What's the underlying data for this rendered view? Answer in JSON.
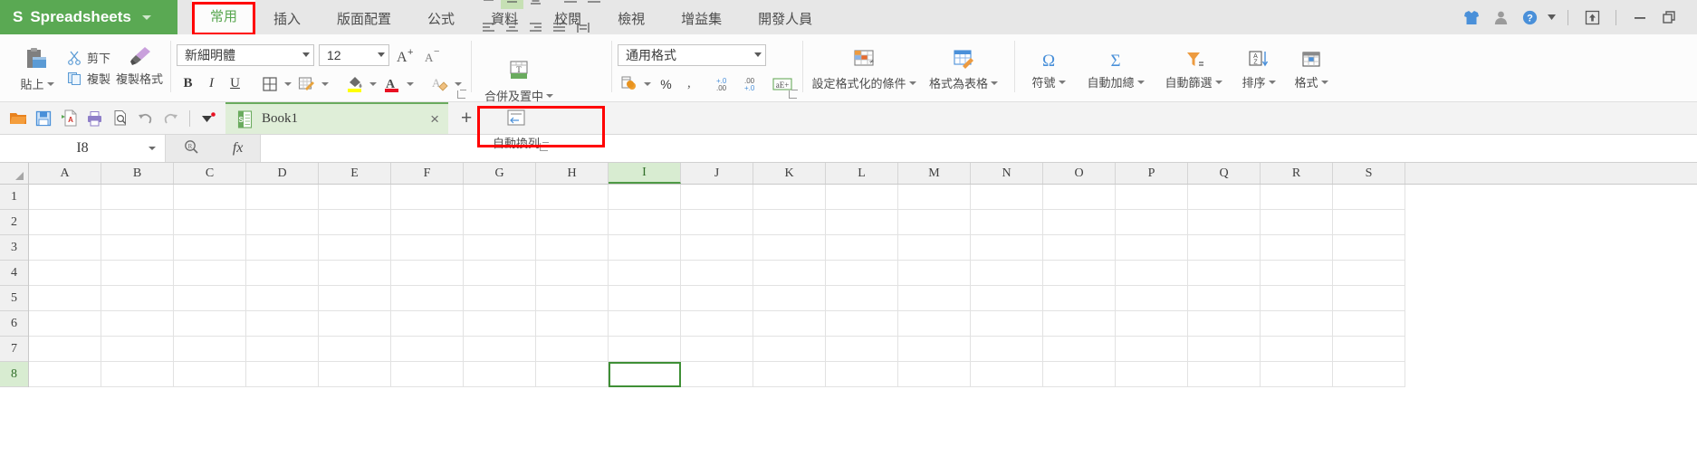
{
  "titlebar": {
    "logo": "S",
    "app_name": "Spreadsheets",
    "brand_color": "#5aa953",
    "tabs": [
      {
        "label": "常用",
        "active": true,
        "highlighted": true
      },
      {
        "label": "插入",
        "active": false,
        "highlighted": false
      },
      {
        "label": "版面配置",
        "active": false,
        "highlighted": false
      },
      {
        "label": "公式",
        "active": false,
        "highlighted": false
      },
      {
        "label": "資料",
        "active": false,
        "highlighted": false
      },
      {
        "label": "校閱",
        "active": false,
        "highlighted": false
      },
      {
        "label": "檢視",
        "active": false,
        "highlighted": false
      },
      {
        "label": "增益集",
        "active": false,
        "highlighted": false
      },
      {
        "label": "開發人員",
        "active": false,
        "highlighted": false
      }
    ],
    "right_icons": [
      {
        "name": "skin-shirt-icon"
      },
      {
        "name": "user-account-icon"
      },
      {
        "name": "help-icon"
      },
      {
        "name": "help-dropdown-caret-icon"
      },
      {
        "name": "upload-share-icon"
      },
      {
        "name": "minimize-icon"
      },
      {
        "name": "restore-icon"
      }
    ]
  },
  "ribbon": {
    "highlight_color": "#ff0000",
    "clipboard": {
      "paste_label": "貼上",
      "cut_label": "剪下",
      "copy_label": "複製",
      "format_painter_label": "複製格式"
    },
    "font": {
      "font_name": "新細明體",
      "font_size": "12",
      "grow_font": "A",
      "shrink_font": "A",
      "bold": "B",
      "italic": "I",
      "underline": "U"
    },
    "alignment": {
      "merge_center_label": "合併及置中",
      "wrap_text_label": "自動換列",
      "wrap_text_highlighted": true
    },
    "number": {
      "format_value": "通用格式",
      "percent": "%",
      "comma": "ʼ"
    },
    "styles": {
      "conditional_formatting_label": "設定格式化的條件",
      "format_as_table_label": "格式為表格"
    },
    "editing": {
      "symbol_label": "符號",
      "symbol_glyph": "Ω",
      "autosum_label": "自動加總",
      "autosum_glyph": "Σ",
      "autofilter_label": "自動篩選",
      "sort_label": "排序",
      "format_label": "格式"
    }
  },
  "quick_access": {
    "icons": [
      {
        "name": "open-folder-icon"
      },
      {
        "name": "save-icon"
      },
      {
        "name": "export-pdf-icon"
      },
      {
        "name": "print-icon"
      },
      {
        "name": "print-preview-icon"
      },
      {
        "name": "undo-icon"
      },
      {
        "name": "redo-icon"
      },
      {
        "name": "customize-qat-icon"
      }
    ]
  },
  "doc_tabs": {
    "tabs": [
      {
        "name": "Book1",
        "active": true
      }
    ],
    "close_glyph": "×",
    "add_glyph": "+"
  },
  "formula_bar": {
    "name_box_value": "I8",
    "lookup_icon": "search-ref-icon",
    "fx_label": "fx",
    "formula_value": ""
  },
  "grid": {
    "columns": [
      "A",
      "B",
      "C",
      "D",
      "E",
      "F",
      "G",
      "H",
      "I",
      "J",
      "K",
      "L",
      "M",
      "N",
      "O",
      "P",
      "Q",
      "R",
      "S"
    ],
    "rows": [
      "1",
      "2",
      "3",
      "4",
      "5",
      "6",
      "7",
      "8"
    ],
    "selected_column": "I",
    "selected_row": "8",
    "active_cell": "I8",
    "selection_color": "#3f8f36",
    "header_selection_bg": "#d8ecd1"
  }
}
